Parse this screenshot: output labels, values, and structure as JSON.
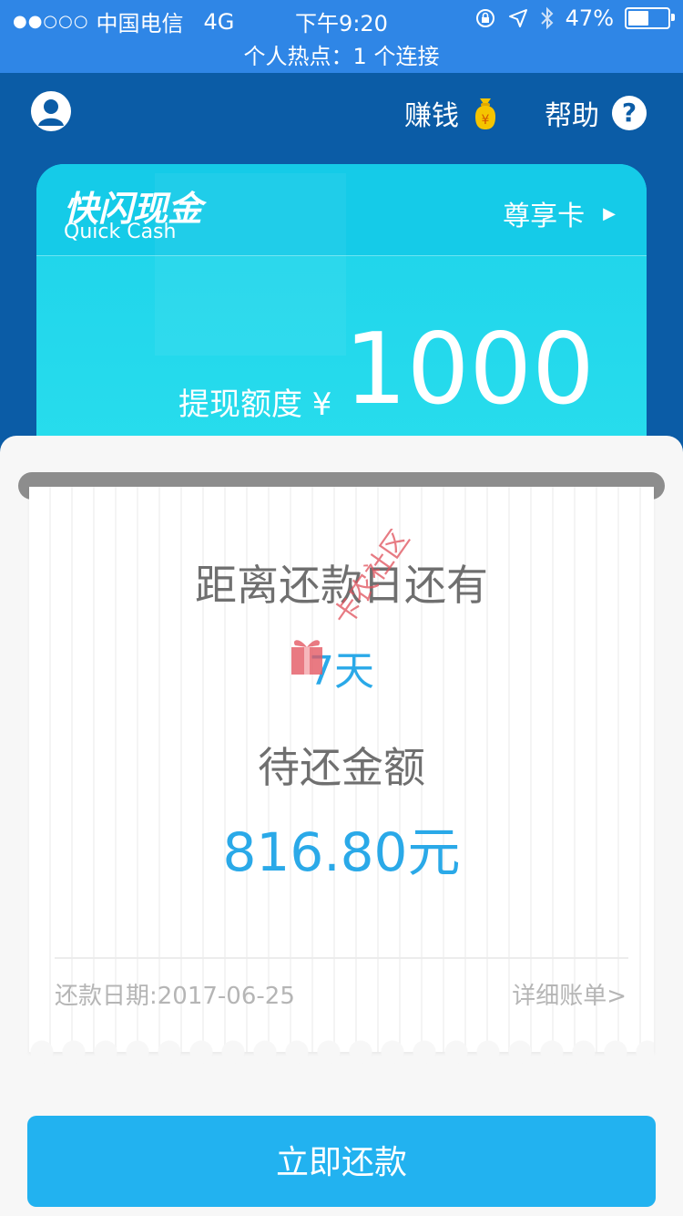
{
  "status_bar": {
    "signal": "●●○○○",
    "carrier": "中国电信",
    "network": "4G",
    "time": "下午9:20",
    "battery_percent": "47%",
    "battery_level": 0.47,
    "hotspot": "个人热点：1 个连接"
  },
  "header": {
    "earn_label": "赚钱",
    "earn_icon_text": "¥",
    "help_label": "帮助",
    "help_icon_text": "?"
  },
  "card": {
    "brand_cn": "快闪现金",
    "brand_en": "Quick Cash",
    "vip_label": "尊享卡",
    "vip_arrow": "▶",
    "limit_label": "提现额度 ¥",
    "limit_value": "1000"
  },
  "ticket": {
    "days_label": "距离还款日还有",
    "days_value": "7天",
    "amount_label": "待还金额",
    "amount_value": "816.80元",
    "due_date": "还款日期:2017-06-25",
    "detail_link": "详细账单>"
  },
  "watermark": {
    "text": "卡农社区"
  },
  "actions": {
    "pay_label": "立即还款"
  },
  "colors": {
    "status_bar": "#2f86e6",
    "header": "#0b5ca6",
    "card": "#1ed2ea",
    "accent": "#2aa9e8",
    "button": "#22b2f0"
  }
}
